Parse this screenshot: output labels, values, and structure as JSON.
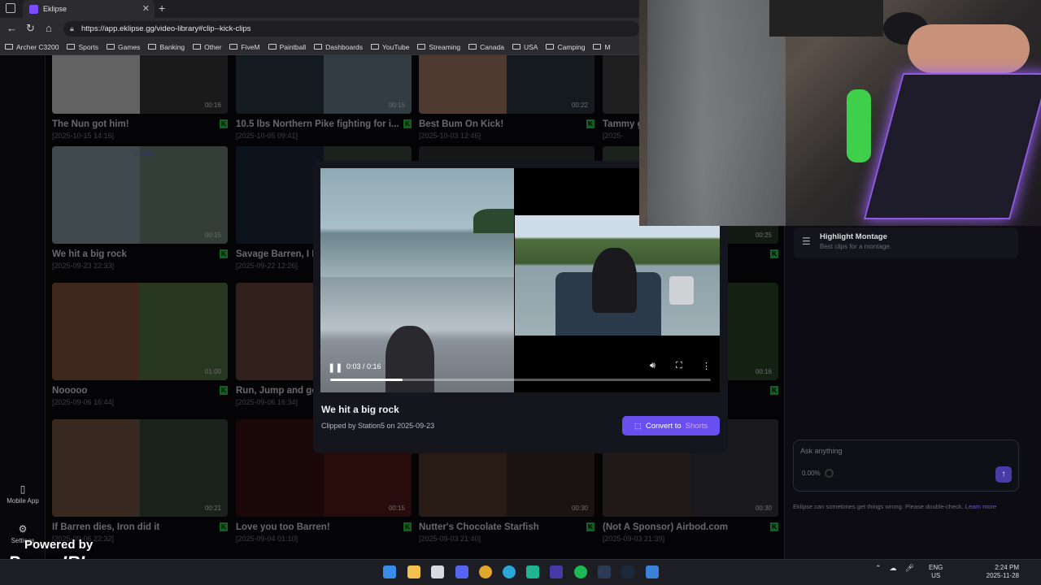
{
  "browser": {
    "tab_title": "Eklipse",
    "url": "https://app.eklipse.gg/video-library#clip--kick-clips",
    "bookmarks": [
      "Archer C3200",
      "Sports",
      "Games",
      "Banking",
      "Other",
      "FiveM",
      "Paintball",
      "Dashboards",
      "YouTube",
      "Streaming",
      "Canada",
      "USA",
      "Camping",
      "M"
    ]
  },
  "sidebar": {
    "mobile_app_label": "Mobile App",
    "settings_label": "Settings"
  },
  "clips": [
    {
      "title": "The Nun got him!",
      "date": "[2025-10-15 14:16]",
      "duration": "00:16",
      "badge": "Viewed"
    },
    {
      "title": "10.5 lbs Northern Pike fighting for i...",
      "date": "[2025-10-05 09:41]",
      "duration": "00:15",
      "badge": "Viewed"
    },
    {
      "title": "Best Bum On Kick!",
      "date": "[2025-10-03 12:46]",
      "duration": "00:22",
      "badge": "Viewed"
    },
    {
      "title": "Tammy g",
      "date": "[2025-",
      "duration": "",
      "badge": ""
    },
    {
      "title": "We hit a big rock",
      "date": "[2025-09-23 22:33]",
      "duration": "00:15",
      "badge": "Viewed"
    },
    {
      "title": "Savage Barren, I L",
      "date": "[2025-09-22 12:26]",
      "duration": "",
      "badge": ""
    },
    {
      "title": "",
      "date": "",
      "duration": "",
      "badge": ""
    },
    {
      "title": "en!",
      "date": "",
      "duration": "00:25",
      "badge": ""
    },
    {
      "title": "Nooooo",
      "date": "[2025-09-06 16:44]",
      "duration": "01:00",
      "badge": ""
    },
    {
      "title": "Run, Jump and ge",
      "date": "[2025-09-06 16:34]",
      "duration": "",
      "badge": ""
    },
    {
      "title": "",
      "date": "",
      "duration": "",
      "badge": ""
    },
    {
      "title": "ever",
      "date": "",
      "duration": "00:16",
      "badge": ""
    },
    {
      "title": "If Barren dies, Iron did it",
      "date": "[2025-09-06 22:32]",
      "duration": "00:21",
      "badge": ""
    },
    {
      "title": "Love you too Barren!",
      "date": "[2025-09-04 01:10]",
      "duration": "00:15",
      "badge": ""
    },
    {
      "title": "Nutter's Chocolate Starfish",
      "date": "[2025-09-03 21:40]",
      "duration": "00:30",
      "badge": ""
    },
    {
      "title": "(Not A Sponsor) Airbod.com",
      "date": "[2025-09-03 21:39]",
      "duration": "00:30",
      "badge": ""
    }
  ],
  "modal": {
    "title": "We hit a big rock",
    "clipped_by": "Clipped by Station5 on 2025-09-23",
    "time": "0:03 / 0:16",
    "progress": 0.19,
    "convert_label": "Convert to",
    "convert_shorts": "Shorts"
  },
  "right_panel": {
    "montage_title": "Highlight Montage",
    "montage_sub": "Best clips for a montage.",
    "ask_placeholder": "Ask anything",
    "ask_percent": "0.00%",
    "disclaimer": "Eklipse can sometimes get things wrong. Please double-check.",
    "learn_more": "Learn more"
  },
  "watermark": {
    "powered_by": "Powered by",
    "brand": "PowerIRL"
  },
  "taskbar": {
    "lang_top": "ENG",
    "lang_bottom": "US",
    "time": "2:24 PM",
    "date": "2025-11-28"
  },
  "colors": {
    "accent": "#6a4ff0",
    "kick_green": "#27d643",
    "background": "#0a0a0f"
  }
}
